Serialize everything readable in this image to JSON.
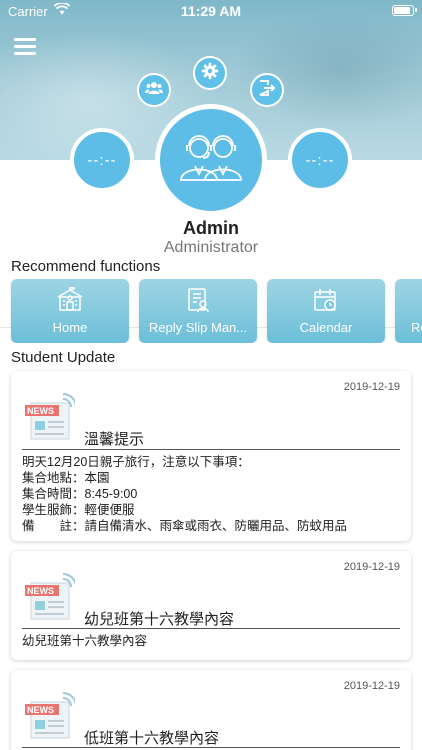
{
  "status_bar": {
    "carrier": "Carrier",
    "time": "11:29 AM"
  },
  "profile": {
    "name": "Admin",
    "role": "Administrator",
    "left_value": "--:--",
    "right_value": "--:--"
  },
  "recommend": {
    "title": "Recommend functions",
    "items": [
      {
        "label": "Home",
        "icon": "school-icon"
      },
      {
        "label": "Reply Slip Man...",
        "icon": "reply-slip-icon"
      },
      {
        "label": "Calendar",
        "icon": "calendar-icon"
      },
      {
        "label": "Re",
        "icon": "partial-icon"
      }
    ]
  },
  "student_update": {
    "title": "Student Update",
    "items": [
      {
        "date": "2019-12-19",
        "title": "溫馨提示",
        "lines": [
          "明天12月20日親子旅行，注意以下事項：",
          "集合地點：本園",
          "集合時間：8:45-9:00",
          "學生服飾：輕便便服",
          "備　　註：請自備清水、雨傘或雨衣、防曬用品、防蚊用品"
        ]
      },
      {
        "date": "2019-12-19",
        "title": "幼兒班第十六教學內容",
        "lines": [
          "幼兒班第十六教學內容"
        ]
      },
      {
        "date": "2019-12-19",
        "title": "低班第十六教學內容",
        "lines": []
      }
    ]
  },
  "news_thumb_label": "NEWS",
  "colors": {
    "accent": "#5ebde6",
    "card_gradient_top": "#9dd4e3",
    "card_gradient_bottom": "#6cbfd9",
    "news_red": "#e8736f"
  }
}
